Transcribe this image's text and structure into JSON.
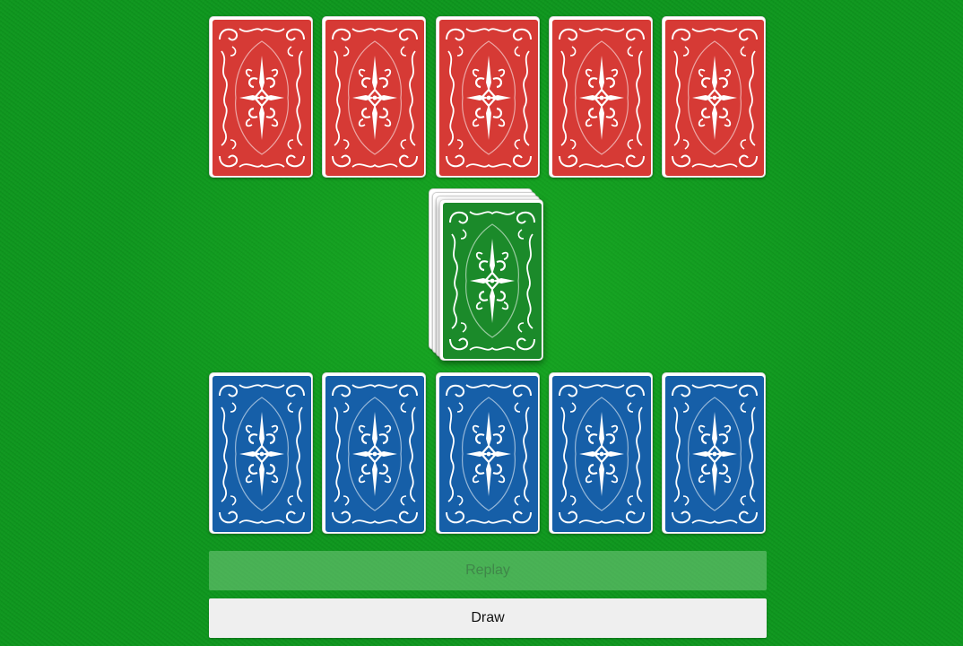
{
  "colors": {
    "felt": "#0f9a1f",
    "opponent_card_back": "#d63a35",
    "player_card_back": "#165fa8",
    "deck_card_back": "#1b8a2a",
    "ornament": "#ffffff"
  },
  "opponent_hand": {
    "cards": [
      {
        "face": "down",
        "back": "red"
      },
      {
        "face": "down",
        "back": "red"
      },
      {
        "face": "down",
        "back": "red"
      },
      {
        "face": "down",
        "back": "red"
      },
      {
        "face": "down",
        "back": "red"
      }
    ]
  },
  "deck": {
    "back": "green",
    "stacked_layers": 4
  },
  "player_hand": {
    "cards": [
      {
        "face": "down",
        "back": "blue"
      },
      {
        "face": "down",
        "back": "blue"
      },
      {
        "face": "down",
        "back": "blue"
      },
      {
        "face": "down",
        "back": "blue"
      },
      {
        "face": "down",
        "back": "blue"
      }
    ]
  },
  "buttons": {
    "replay_label": "Replay",
    "replay_enabled": false,
    "draw_label": "Draw"
  }
}
